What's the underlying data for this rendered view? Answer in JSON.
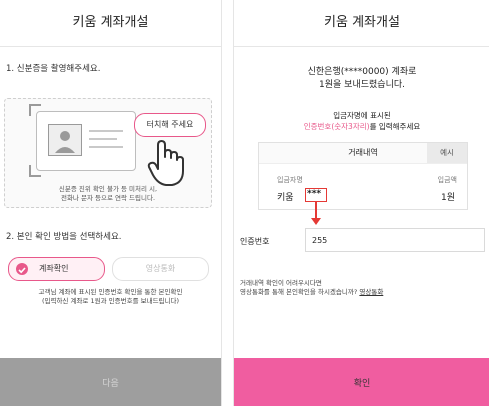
{
  "left": {
    "title": "키움 계좌개설",
    "step1": "1. 신분증을 촬영해주세요.",
    "touch_label": "터치해 주세요",
    "notice_line1": "신분증 진위 확인 불가 등 미처리 시,",
    "notice_line2": "전화나 문자 등으로 연락 드립니다.",
    "step2": "2. 본인 확인 방법을 선택하세요.",
    "option_account": "계좌확인",
    "option_video": "영상통화",
    "desc_line1": "고객님 계좌에 표시된 인증번호 확인을 통한 본인확인",
    "desc_line2": "(입력하신 계좌로 1원과 인증번호를 보내드립니다)",
    "next_button": "다음"
  },
  "right": {
    "title": "키움 계좌개설",
    "msg_line1": "신한은행(****0000) 계좌로",
    "msg_line2": "1원을 보내드렸습니다.",
    "instr_line1": "입금자명에 표시된",
    "instr_code": "인증번호(숫자3자리)",
    "instr_suffix": "를 입력해주세요",
    "table_title": "거래내역",
    "table_tab": "예시",
    "col_depositor": "입금자명",
    "col_amount": "입금액",
    "depositor_name": "키움",
    "depositor_code": "***",
    "amount": "1원",
    "code_label": "인증번호",
    "code_value": "255",
    "help_line1": "거래내역 확인이 어려우시다면",
    "help_line2": "영상통화를 통해 본인확인을 하시겠습니까?",
    "help_link": "영상통화",
    "confirm_button": "확인"
  },
  "colors": {
    "accent": "#e8588a",
    "confirm_bg": "#f05da0",
    "next_bg": "#9e9e9e",
    "highlight": "#e53935"
  }
}
